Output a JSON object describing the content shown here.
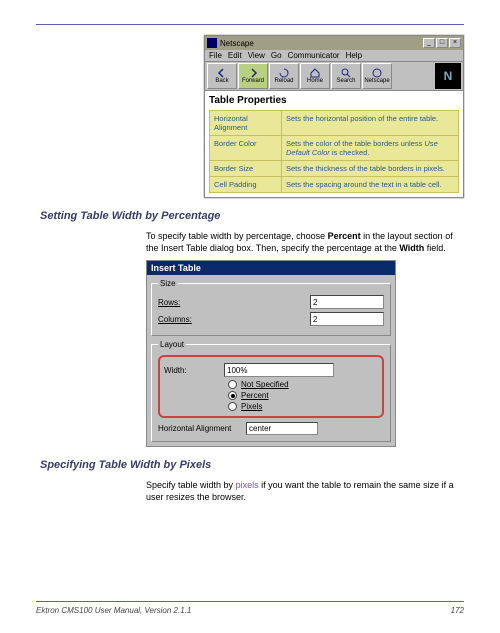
{
  "netscape": {
    "title": "Netscape",
    "menus": [
      "File",
      "Edit",
      "View",
      "Go",
      "Communicator",
      "Help"
    ],
    "toolbar": [
      {
        "name": "back-btn",
        "label": "Back"
      },
      {
        "name": "forward-btn",
        "label": "Forward"
      },
      {
        "name": "reload-btn",
        "label": "Reload"
      },
      {
        "name": "home-btn",
        "label": "Home"
      },
      {
        "name": "search-btn",
        "label": "Search"
      },
      {
        "name": "netscape-btn",
        "label": "Netscape"
      }
    ],
    "content_title": "Table Properties",
    "rows": [
      {
        "label": "Horizontal Alignment",
        "desc": "Sets the horizontal position of the entire table."
      },
      {
        "label": "Border Color",
        "desc": "Sets the color of the table borders unless <i>Use Default Color</i> is checked."
      },
      {
        "label": "Border Size",
        "desc": "Sets the thickness of the table borders in pixels."
      },
      {
        "label": "Cell Padding",
        "desc": "Sets the spacing around the text in a table cell."
      }
    ]
  },
  "section1": {
    "heading": "Setting Table Width by Percentage",
    "para_before": "To specify table width by percentage, choose ",
    "bold1": "Percent",
    "para_mid": " in the layout section of the Insert Table dialog box. Then, specify the percentage at the ",
    "bold2": "Width",
    "para_after": " field."
  },
  "dialog": {
    "title": "Insert Table",
    "size_legend": "Size",
    "rows_label": "Rows:",
    "rows_value": "2",
    "cols_label": "Columns:",
    "cols_value": "2",
    "layout_legend": "Layout",
    "width_label": "Width:",
    "width_value": "100%",
    "radio_not": "Not Specified",
    "radio_percent": "Percent",
    "radio_pixels": "Pixels",
    "halign_label": "Horizontal Alignment",
    "halign_value": "center"
  },
  "section2": {
    "heading": "Specifying Table Width by Pixels",
    "para_before": "Specify table width by ",
    "link": "pixels",
    "para_after": " if you want the table to remain the same size if a user resizes the browser."
  },
  "footer": {
    "left": "Ektron CMS100 User Manual, Version 2.1.1",
    "right": "172"
  }
}
